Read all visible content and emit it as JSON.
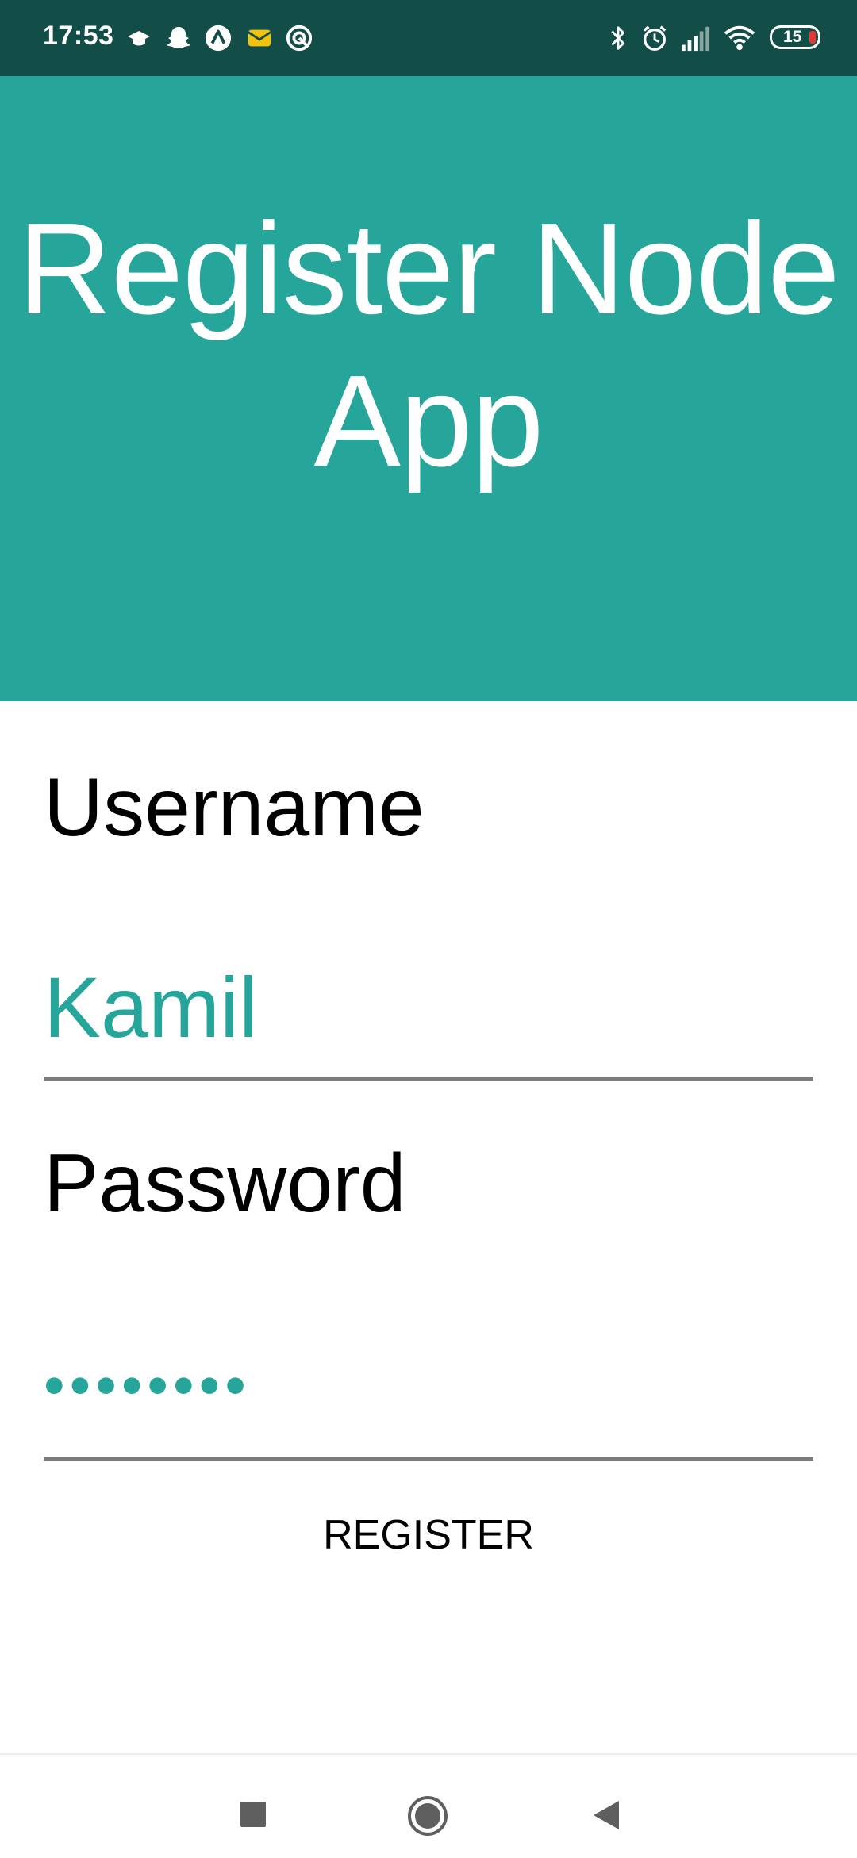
{
  "status_bar": {
    "time": "17:53",
    "battery": "15",
    "icons": [
      "graduation-cap-icon",
      "snapchat-icon",
      "arrow-icon",
      "mail-icon",
      "app-icon",
      "bluetooth-icon",
      "alarm-icon",
      "signal-icon",
      "wifi-icon",
      "battery-icon"
    ]
  },
  "header": {
    "title": "Register Node App"
  },
  "form": {
    "username_label": "Username",
    "username_value": "Kamil",
    "password_label": "Password",
    "password_value": "kamil123",
    "register_label": "REGISTER"
  },
  "nav_bar": {
    "icons": [
      "recents-icon",
      "home-icon",
      "back-icon"
    ]
  },
  "colors": {
    "status_bar": "#134d48",
    "header": "#26a69a",
    "accent": "#26a69a",
    "underline": "#7b7b7b"
  }
}
